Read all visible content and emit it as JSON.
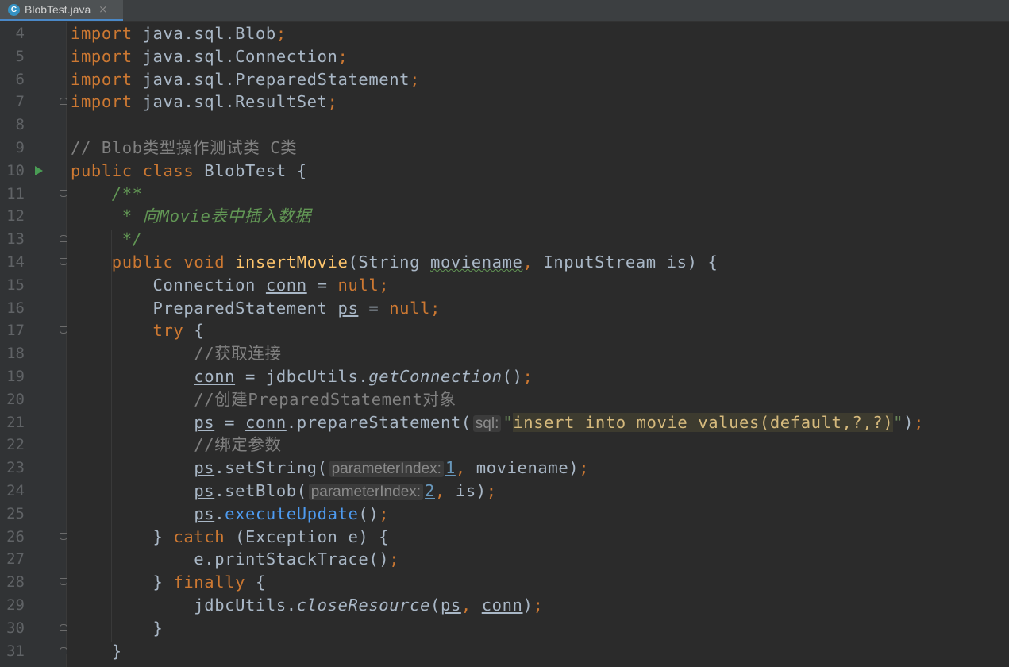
{
  "tab": {
    "title": "BlobTest.java",
    "icon_letter": "C",
    "close_glyph": "×"
  },
  "colors": {
    "background": "#2b2b2b",
    "keyword": "#cc7832",
    "comment": "#808080",
    "doc_comment": "#629755",
    "string": "#6a8759",
    "number": "#6897bb",
    "default": "#a9b7c6"
  },
  "lines": [
    {
      "n": "4",
      "parts": [
        {
          "t": "import",
          "c": "kw"
        },
        {
          "t": " java.sql.Blob"
        },
        {
          "t": ";",
          "c": "kw"
        }
      ]
    },
    {
      "n": "5",
      "parts": [
        {
          "t": "import",
          "c": "kw"
        },
        {
          "t": " java.sql.Connection"
        },
        {
          "t": ";",
          "c": "kw"
        }
      ]
    },
    {
      "n": "6",
      "parts": [
        {
          "t": "import",
          "c": "kw"
        },
        {
          "t": " java.sql.PreparedStatement"
        },
        {
          "t": ";",
          "c": "kw"
        }
      ]
    },
    {
      "n": "7",
      "fold": "close",
      "parts": [
        {
          "t": "import",
          "c": "kw"
        },
        {
          "t": " java.sql.ResultSet"
        },
        {
          "t": ";",
          "c": "kw"
        }
      ]
    },
    {
      "n": "8",
      "parts": []
    },
    {
      "n": "9",
      "parts": [
        {
          "t": "// Blob类型操作测试类 C类",
          "c": "cm"
        }
      ]
    },
    {
      "n": "10",
      "run": true,
      "parts": [
        {
          "t": "public class ",
          "c": "kw"
        },
        {
          "t": "BlobTest {"
        }
      ]
    },
    {
      "n": "11",
      "fold": "open",
      "parts": [
        {
          "t": "    "
        },
        {
          "t": "/**",
          "c": "doc"
        }
      ]
    },
    {
      "n": "12",
      "parts": [
        {
          "t": "     * 向Movie表中插入数据",
          "c": "doc"
        }
      ]
    },
    {
      "n": "13",
      "fold": "close",
      "parts": [
        {
          "t": "     */",
          "c": "doc"
        }
      ]
    },
    {
      "n": "14",
      "fold": "open",
      "parts": [
        {
          "t": "    "
        },
        {
          "t": "public void ",
          "c": "kw"
        },
        {
          "t": "insertMovie",
          "c": "fn"
        },
        {
          "t": "(String "
        },
        {
          "t": "moviename",
          "c": "err"
        },
        {
          "t": ", ",
          "c": "kw"
        },
        {
          "t": "InputStream is) {"
        }
      ]
    },
    {
      "n": "15",
      "parts": [
        {
          "t": "        Connection "
        },
        {
          "t": "conn",
          "c": "var"
        },
        {
          "t": " = "
        },
        {
          "t": "null;",
          "c": "kw"
        }
      ]
    },
    {
      "n": "16",
      "parts": [
        {
          "t": "        PreparedStatement "
        },
        {
          "t": "ps",
          "c": "var"
        },
        {
          "t": " = "
        },
        {
          "t": "null;",
          "c": "kw"
        }
      ]
    },
    {
      "n": "17",
      "fold": "open",
      "parts": [
        {
          "t": "        "
        },
        {
          "t": "try ",
          "c": "kw"
        },
        {
          "t": "{"
        }
      ]
    },
    {
      "n": "18",
      "parts": [
        {
          "t": "            //获取连接",
          "c": "cm"
        }
      ]
    },
    {
      "n": "19",
      "parts": [
        {
          "t": "            "
        },
        {
          "t": "conn",
          "c": "var"
        },
        {
          "t": " = jdbcUtils."
        },
        {
          "t": "getConnection",
          "c": "italic"
        },
        {
          "t": "()"
        },
        {
          "t": ";",
          "c": "kw"
        }
      ]
    },
    {
      "n": "20",
      "parts": [
        {
          "t": "            //创建PreparedStatement对象",
          "c": "cm"
        }
      ]
    },
    {
      "n": "21",
      "parts": [
        {
          "t": "            "
        },
        {
          "t": "ps",
          "c": "var"
        },
        {
          "t": " = "
        },
        {
          "t": "conn",
          "c": "var"
        },
        {
          "t": ".prepareStatement("
        },
        {
          "t": "sql:",
          "c": "hint"
        },
        {
          "t": "\"",
          "c": "st"
        },
        {
          "t": "insert into movie values(default,?,?)",
          "c": "hlstr"
        },
        {
          "t": "\"",
          "c": "st"
        },
        {
          "t": ")"
        },
        {
          "t": ";",
          "c": "kw"
        }
      ]
    },
    {
      "n": "22",
      "parts": [
        {
          "t": "            //绑定参数",
          "c": "cm"
        }
      ]
    },
    {
      "n": "23",
      "parts": [
        {
          "t": "            "
        },
        {
          "t": "ps",
          "c": "var"
        },
        {
          "t": ".setString("
        },
        {
          "t": "parameterIndex:",
          "c": "hint"
        },
        {
          "t": "1",
          "c": "num"
        },
        {
          "t": ", ",
          "c": "kw"
        },
        {
          "t": "moviename)"
        },
        {
          "t": ";",
          "c": "kw"
        }
      ]
    },
    {
      "n": "24",
      "parts": [
        {
          "t": "            "
        },
        {
          "t": "ps",
          "c": "var"
        },
        {
          "t": ".setBlob("
        },
        {
          "t": "parameterIndex:",
          "c": "hint"
        },
        {
          "t": "2",
          "c": "num"
        },
        {
          "t": ", ",
          "c": "kw"
        },
        {
          "t": "is)"
        },
        {
          "t": ";",
          "c": "kw"
        }
      ]
    },
    {
      "n": "25",
      "parts": [
        {
          "t": "            "
        },
        {
          "t": "ps",
          "c": "var"
        },
        {
          "t": "."
        },
        {
          "t": "executeUpdate",
          "c": "call"
        },
        {
          "t": "()"
        },
        {
          "t": ";",
          "c": "kw"
        }
      ]
    },
    {
      "n": "26",
      "fold": "open",
      "parts": [
        {
          "t": "        } "
        },
        {
          "t": "catch ",
          "c": "kw"
        },
        {
          "t": "(Exception e) {"
        }
      ]
    },
    {
      "n": "27",
      "parts": [
        {
          "t": "            e.printStackTrace()"
        },
        {
          "t": ";",
          "c": "kw"
        }
      ]
    },
    {
      "n": "28",
      "fold": "open",
      "parts": [
        {
          "t": "        } "
        },
        {
          "t": "finally ",
          "c": "kw"
        },
        {
          "t": "{"
        }
      ]
    },
    {
      "n": "29",
      "parts": [
        {
          "t": "            jdbcUtils."
        },
        {
          "t": "closeResource",
          "c": "italic"
        },
        {
          "t": "("
        },
        {
          "t": "ps",
          "c": "var"
        },
        {
          "t": ", ",
          "c": "kw"
        },
        {
          "t": "conn",
          "c": "var"
        },
        {
          "t": ")"
        },
        {
          "t": ";",
          "c": "kw"
        }
      ]
    },
    {
      "n": "30",
      "fold": "close",
      "parts": [
        {
          "t": "        }"
        }
      ]
    },
    {
      "n": "31",
      "fold": "close",
      "parts": [
        {
          "t": "    }"
        }
      ]
    }
  ]
}
